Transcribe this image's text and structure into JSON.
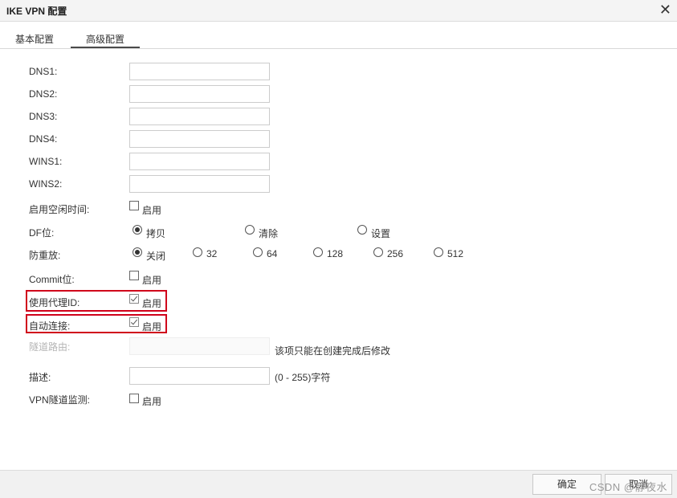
{
  "window": {
    "title": "IKE VPN 配置",
    "close_glyph": "✕"
  },
  "tabs": [
    {
      "label": "基本配置"
    },
    {
      "label": "高级配置"
    }
  ],
  "fields": {
    "dns1": {
      "label": "DNS1:",
      "value": ""
    },
    "dns2": {
      "label": "DNS2:",
      "value": ""
    },
    "dns3": {
      "label": "DNS3:",
      "value": ""
    },
    "dns4": {
      "label": "DNS4:",
      "value": ""
    },
    "wins1": {
      "label": "WINS1:",
      "value": ""
    },
    "wins2": {
      "label": "WINS2:",
      "value": ""
    },
    "idle_time": {
      "label": "启用空闲时间:",
      "option": "启用",
      "checked": false
    },
    "df_bit": {
      "label": "DF位:",
      "options": [
        "拷贝",
        "清除",
        "设置"
      ],
      "selected": "拷贝"
    },
    "anti_replay": {
      "label": "防重放:",
      "options": [
        "关闭",
        "32",
        "64",
        "128",
        "256",
        "512"
      ],
      "selected": "关闭"
    },
    "commit_bit": {
      "label": "Commit位:",
      "option": "启用",
      "checked": false
    },
    "proxy_id": {
      "label": "使用代理ID:",
      "option": "启用",
      "checked": true
    },
    "auto_connect": {
      "label": "自动连接:",
      "option": "启用",
      "checked": true
    },
    "tunnel_route": {
      "label": "隧道路由:",
      "value": "",
      "hint": "该项只能在创建完成后修改"
    },
    "description": {
      "label": "描述:",
      "value": "",
      "hint": "(0 - 255)字符"
    },
    "tunnel_monitor": {
      "label": "VPN隧道监测:",
      "option": "启用",
      "checked": false
    }
  },
  "footer": {
    "ok_label": "确定",
    "cancel_label": "取消",
    "watermark": "CSDN @静夜水"
  },
  "colors": {
    "highlight": "#d0021b"
  }
}
